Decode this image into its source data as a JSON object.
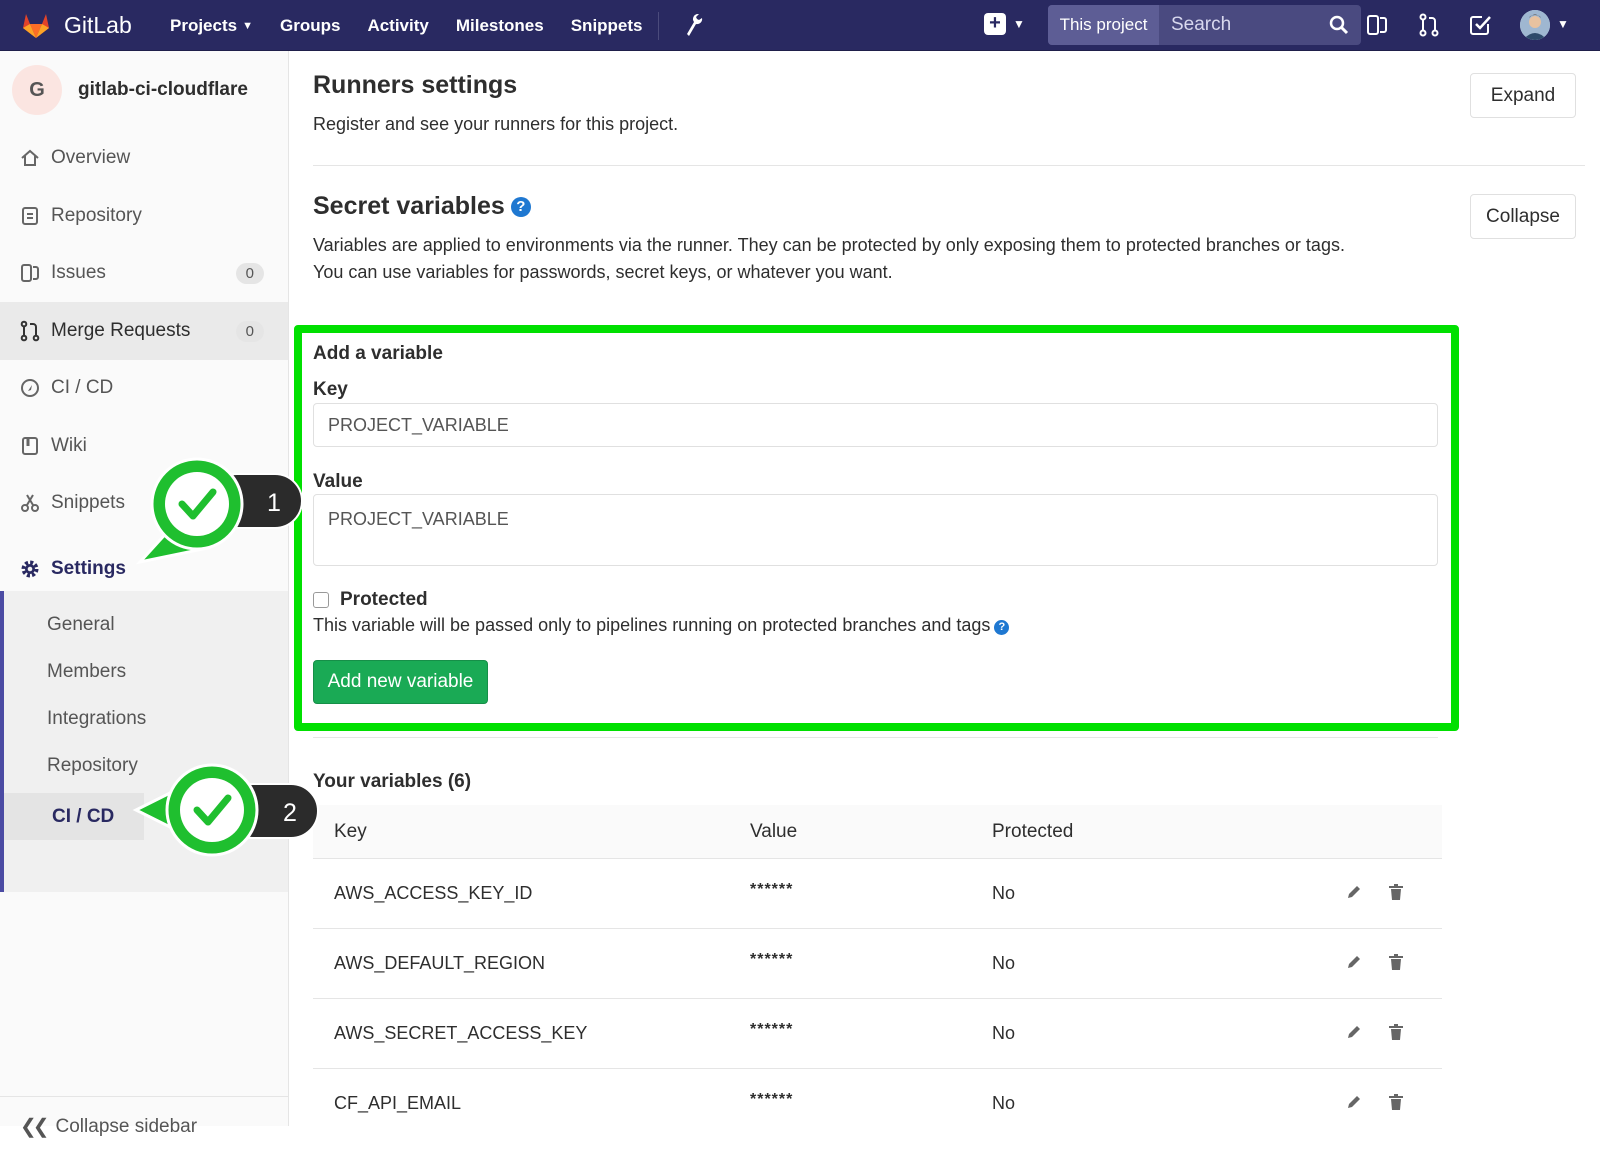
{
  "navbar": {
    "brand": "GitLab",
    "links": [
      {
        "label": "Projects",
        "dropdown": true
      },
      {
        "label": "Groups",
        "dropdown": false
      },
      {
        "label": "Activity",
        "dropdown": false
      },
      {
        "label": "Milestones",
        "dropdown": false
      },
      {
        "label": "Snippets",
        "dropdown": false
      }
    ],
    "search_scope": "This project",
    "search_placeholder": "Search",
    "colors": {
      "bar": "#292961",
      "logo": "#e24329"
    }
  },
  "sidebar": {
    "project_initial": "G",
    "project_name": "gitlab-ci-cloudflare",
    "items": [
      {
        "label": "Overview",
        "icon": "home-icon"
      },
      {
        "label": "Repository",
        "icon": "doc-icon"
      },
      {
        "label": "Issues",
        "icon": "issues-icon",
        "badge": "0"
      },
      {
        "label": "Merge Requests",
        "icon": "merge-request-icon",
        "badge": "0"
      },
      {
        "label": "CI / CD",
        "icon": "rocket-icon"
      },
      {
        "label": "Wiki",
        "icon": "book-icon"
      },
      {
        "label": "Snippets",
        "icon": "scissors-icon"
      },
      {
        "label": "Settings",
        "icon": "gear-icon"
      }
    ],
    "settings_sub": [
      "General",
      "Members",
      "Integrations",
      "Repository",
      "CI / CD"
    ],
    "collapse_label": "Collapse sidebar"
  },
  "runners": {
    "title": "Runners settings",
    "desc": "Register and see your runners for this project.",
    "button": "Expand"
  },
  "secret_vars": {
    "title": "Secret variables",
    "desc_line1": "Variables are applied to environments via the runner. They can be protected by only exposing them to protected branches or tags.",
    "desc_line2": "You can use variables for passwords, secret keys, or whatever you want.",
    "button": "Collapse"
  },
  "add_form": {
    "heading": "Add a variable",
    "key_label": "Key",
    "key_value": "PROJECT_VARIABLE",
    "value_label": "Value",
    "value_value": "PROJECT_VARIABLE",
    "protected_label": "Protected",
    "protected_checked": false,
    "protected_help": "This variable will be passed only to pipelines running on protected branches and tags",
    "submit": "Add new variable"
  },
  "variables": {
    "title": "Your variables (6)",
    "columns": [
      "Key",
      "Value",
      "Protected"
    ],
    "rows": [
      {
        "key": "AWS_ACCESS_KEY_ID",
        "value": "******",
        "protected": "No"
      },
      {
        "key": "AWS_DEFAULT_REGION",
        "value": "******",
        "protected": "No"
      },
      {
        "key": "AWS_SECRET_ACCESS_KEY",
        "value": "******",
        "protected": "No"
      },
      {
        "key": "CF_API_EMAIL",
        "value": "******",
        "protected": "No"
      }
    ]
  },
  "callouts": [
    {
      "number": "1"
    },
    {
      "number": "2"
    }
  ],
  "highlight_color": "#00e000"
}
